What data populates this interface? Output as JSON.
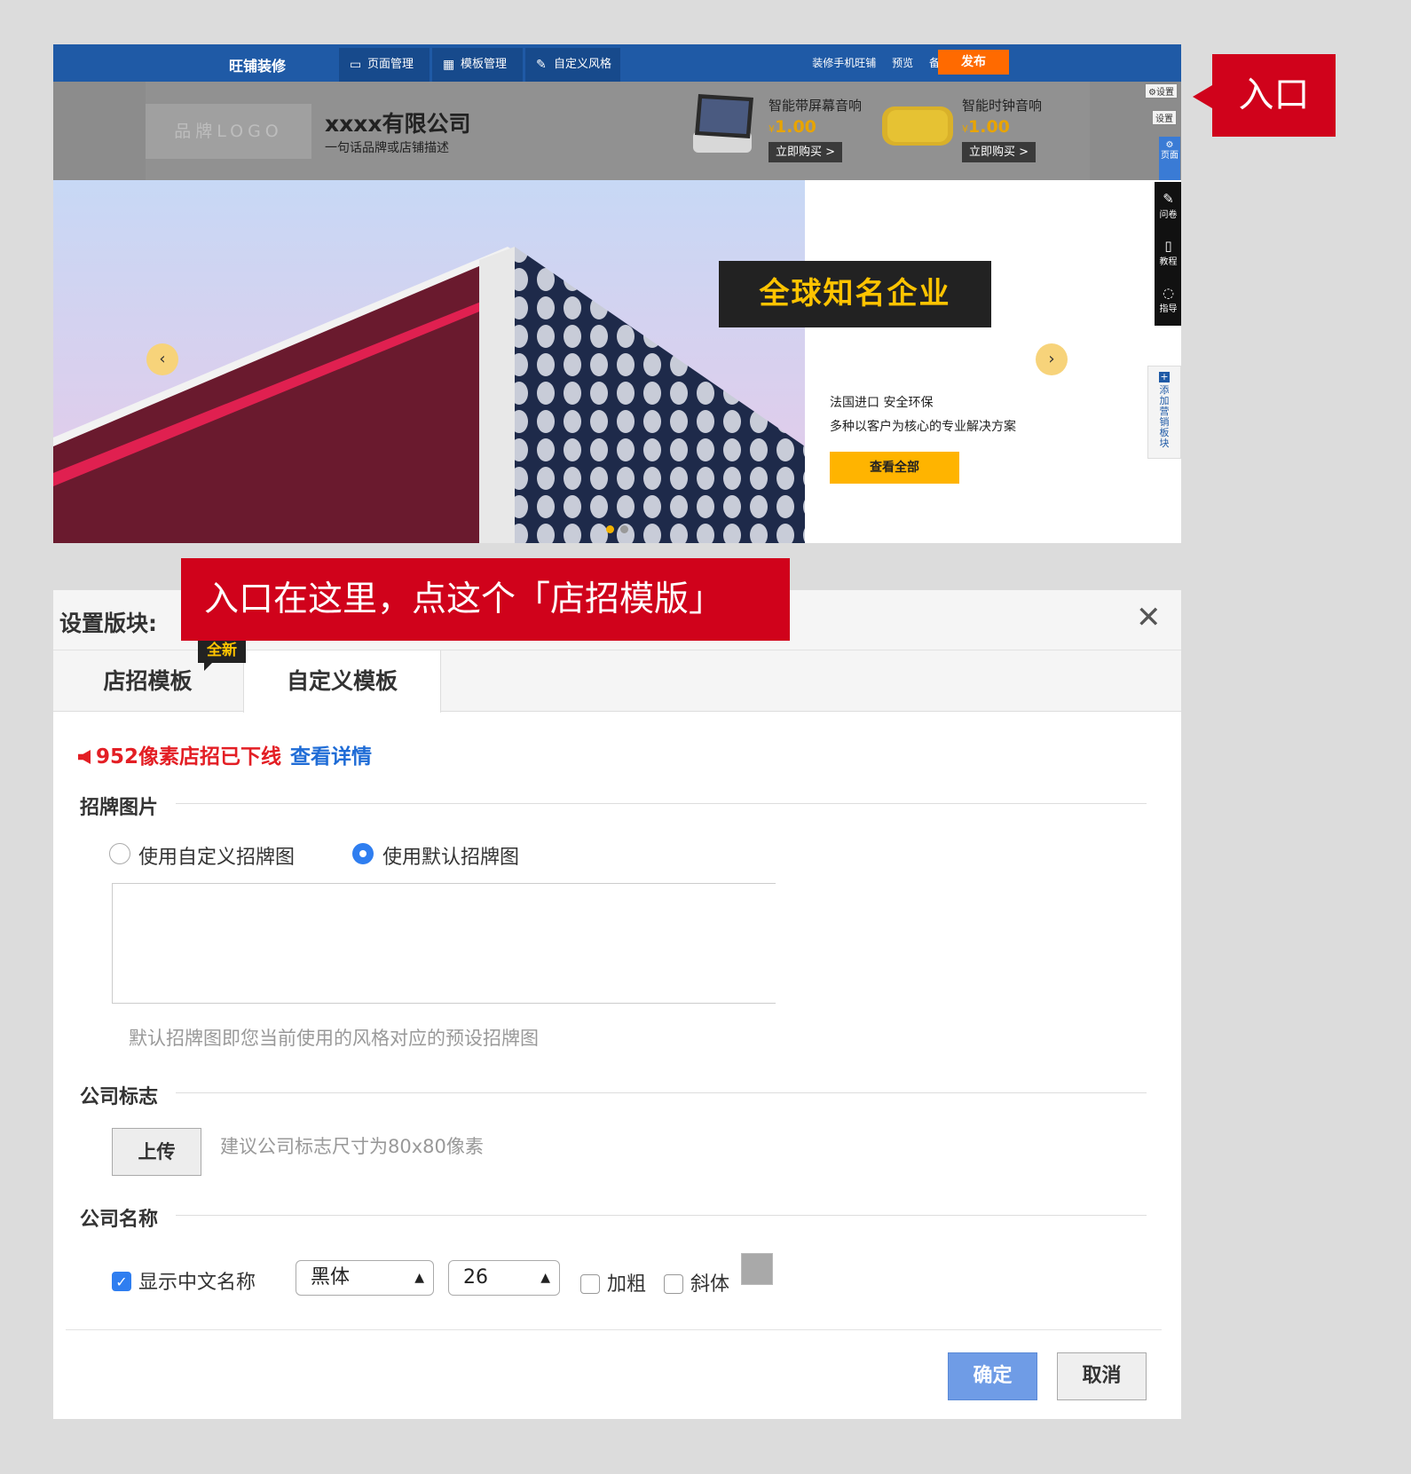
{
  "editor": {
    "brand": "旺铺装修",
    "tabs": [
      {
        "label": "页面管理",
        "icon": "page-icon"
      },
      {
        "label": "模板管理",
        "icon": "grid-icon"
      },
      {
        "label": "自定义风格",
        "icon": "brush-icon"
      }
    ],
    "links": [
      "装修手机旺铺",
      "预览",
      "备份"
    ],
    "publish": "发布"
  },
  "signboard": {
    "logo_placeholder": "品牌LOGO",
    "company_name": "xxxx有限公司",
    "company_desc": "一句话品牌或店铺描述",
    "products": [
      {
        "title": "智能带屏幕音响",
        "currency": "¥",
        "price": "1.00",
        "buy": "立即购买 >"
      },
      {
        "title": "智能时钟音响",
        "currency": "¥",
        "price": "1.00",
        "buy": "立即购买 >"
      }
    ],
    "settings_labels": [
      "设置",
      "设置"
    ],
    "page_tag": "页面"
  },
  "banner": {
    "title": "全球知名企业",
    "sub1": "法国进口 安全环保",
    "sub2": "多种以客户为核心的专业解决方案",
    "view_all": "查看全部",
    "prev": "‹",
    "next": "›"
  },
  "side_tools": [
    {
      "label": "问卷",
      "icon": "edit-icon"
    },
    {
      "label": "教程",
      "icon": "book-icon"
    },
    {
      "label": "指导",
      "icon": "chat-icon"
    }
  ],
  "add_market": "添加营销板块",
  "callouts": {
    "entry": "入口",
    "tip": "入口在这里，点这个「店招模版」"
  },
  "dialog": {
    "title": "设置版块:",
    "close": "✕",
    "tabs": [
      "店招模板",
      "自定义模板"
    ],
    "new_badge": "全新",
    "notice_text": "952像素店招已下线",
    "notice_link": "查看详情",
    "sections": {
      "sign_image": "招牌图片",
      "logo": "公司标志",
      "name": "公司名称"
    },
    "radio_custom": "使用自定义招牌图",
    "radio_default": "使用默认招牌图",
    "default_hint": "默认招牌图即您当前使用的风格对应的预设招牌图",
    "upload": "上传",
    "upload_hint": "建议公司标志尺寸为80x80像素",
    "show_cn_name": "显示中文名称",
    "font_select": "黑体",
    "size_select": "26",
    "bold": "加粗",
    "italic": "斜体",
    "color_swatch": "#a9a9a9",
    "ok": "确定",
    "cancel": "取消"
  }
}
